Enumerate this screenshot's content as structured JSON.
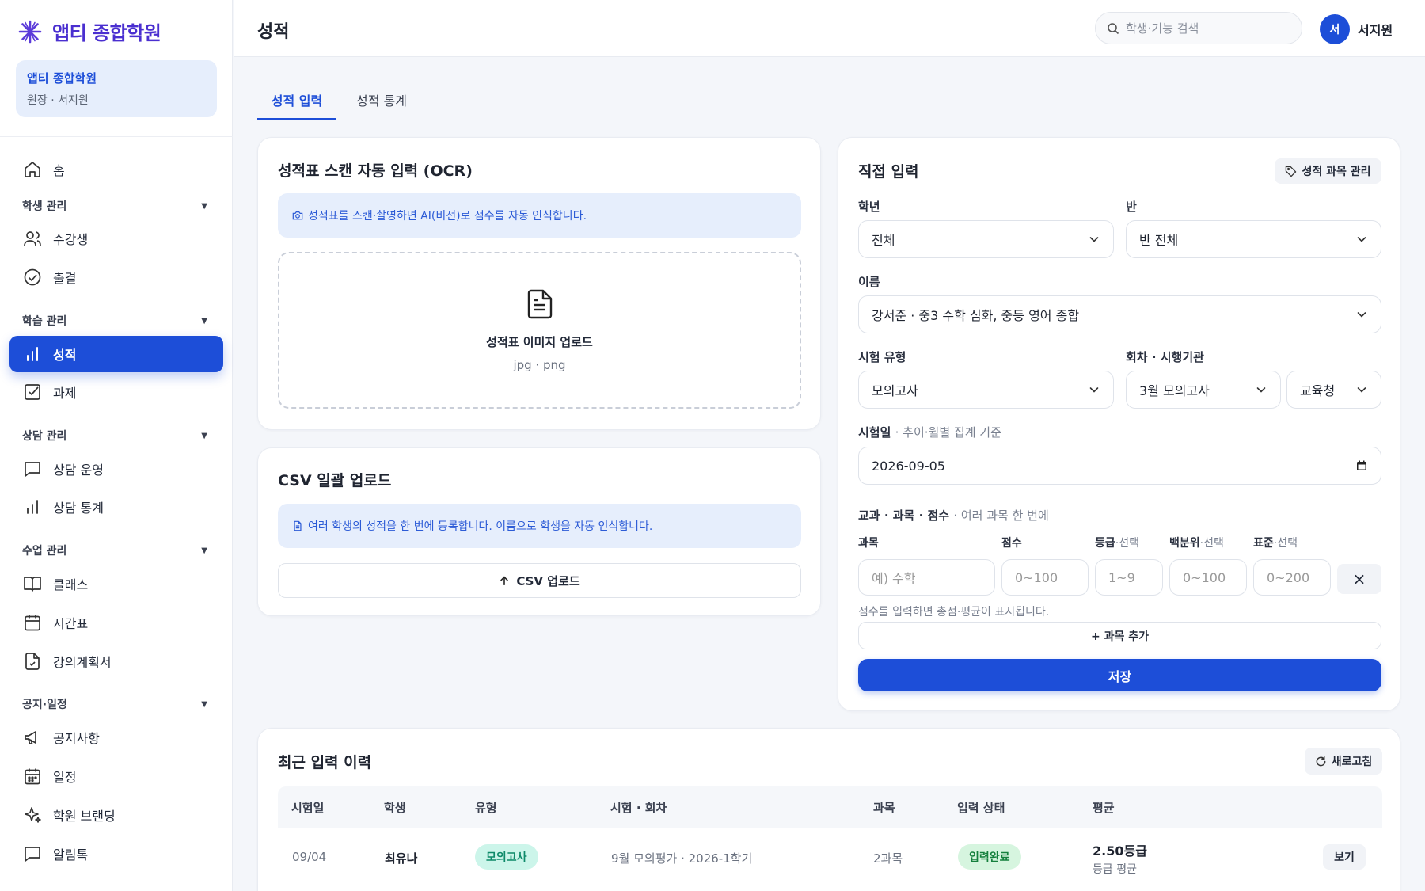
{
  "brand": {
    "name": "앱티 종합학원"
  },
  "org": {
    "name": "앱티 종합학원",
    "role": "원장 · 서지원"
  },
  "nav": {
    "home": "홈",
    "student_group": "학생 관리",
    "students": "수강생",
    "attendance": "출결",
    "study_group": "학습 관리",
    "grades": "성적",
    "assignments": "과제",
    "counsel_group": "상담 관리",
    "counsel_ops": "상담 운영",
    "counsel_stats": "상담 통계",
    "class_group": "수업 관리",
    "classes": "클래스",
    "timetable": "시간표",
    "syllabus": "강의계획서",
    "notice_group": "공지·일정",
    "notices": "공지사항",
    "schedule": "일정",
    "branding": "학원 브랜딩",
    "alimtalk": "알림톡"
  },
  "header": {
    "title": "성적",
    "search_placeholder": "학생·기능 검색",
    "avatar_initial": "서",
    "user_name": "서지원"
  },
  "tabs": [
    "성적 입력",
    "성적 통계"
  ],
  "ocr": {
    "title": "성적표 스캔 자동 입력 (OCR)",
    "info": "성적표를 스캔·촬영하면 AI(비전)로 점수를 자동 인식합니다.",
    "upload_title": "성적표 이미지 업로드",
    "upload_formats": "jpg · png"
  },
  "csv": {
    "title": "CSV 일괄 업로드",
    "info": "여러 학생의 성적을 한 번에 등록합니다. 이름으로 학생을 자동 인식합니다.",
    "button": "CSV 업로드"
  },
  "direct": {
    "title": "직접 입력",
    "manage_subjects": "성적 과목 관리",
    "grade_label": "학년",
    "grade_value": "전체",
    "class_label": "반",
    "class_value": "반 전체",
    "name_label": "이름",
    "name_value": "강서준 · 중3 수학 심화, 중등 영어 종합",
    "exam_type_label": "시험 유형",
    "exam_type_value": "모의고사",
    "round_label": "회차 · 시행기관",
    "round_value": "3월 모의고사",
    "agency_value": "교육청",
    "date_label": "시험일",
    "date_hint": "· 추이·월별 집계 기준",
    "date_value": "2026-09-05",
    "subjects_label": "교과 · 과목 · 점수",
    "subjects_hint": "· 여러 과목 한 번에",
    "col_subject": "과목",
    "col_score": "점수",
    "col_grade": "등급",
    "col_grade_hint": "·선택",
    "col_percentile": "백분위",
    "col_percentile_hint": "·선택",
    "col_standard": "표준",
    "col_standard_hint": "·선택",
    "ph_subject": "예) 수학",
    "ph_score": "0~100",
    "ph_grade": "1~9",
    "ph_percentile": "0~100",
    "ph_standard": "0~200",
    "remove": "×",
    "total_hint": "점수를 입력하면 총점·평균이 표시됩니다.",
    "add_subject": "+ 과목 추가",
    "save": "저장"
  },
  "recent": {
    "title": "최근 입력 이력",
    "refresh": "새로고침",
    "columns": [
      "시험일",
      "학생",
      "유형",
      "시험 · 회차",
      "과목",
      "입력 상태",
      "평균"
    ],
    "rows": [
      {
        "date": "09/04",
        "student": "최유나",
        "type": "모의고사",
        "exam": "9월 모의평가 · 2026-1학기",
        "subjects": "2과목",
        "status": "입력완료",
        "avg": "2.50등급",
        "avg_sub": "등급 평균",
        "action": "보기"
      }
    ]
  },
  "colors": {
    "primary": "#1d4ed8",
    "brand": "#4a2fd0",
    "info_bg": "#e6eefc",
    "mint": "#ccf5ea",
    "green": "#d6f5df"
  }
}
